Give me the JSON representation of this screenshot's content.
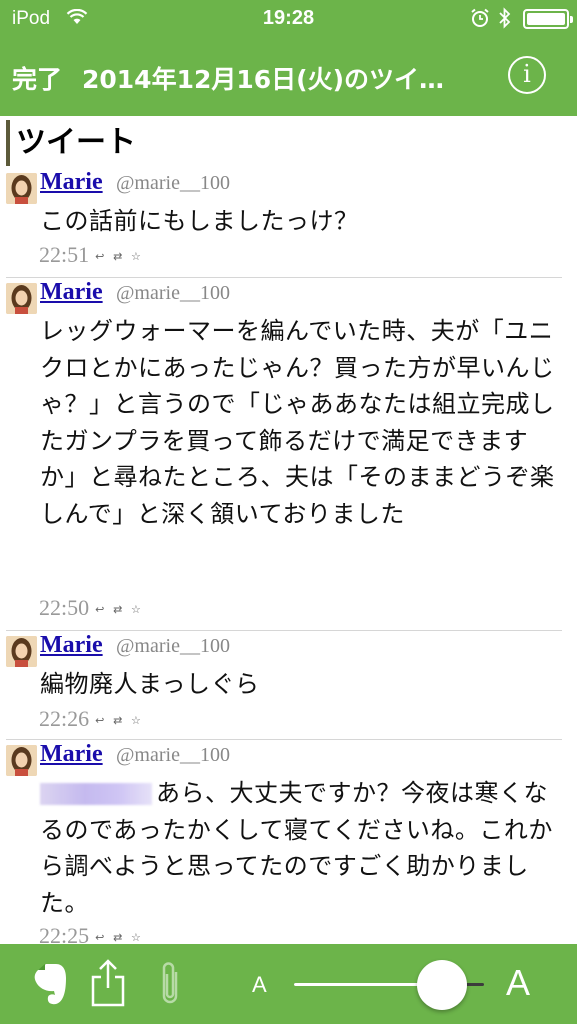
{
  "colors": {
    "accent": "#6cb44a",
    "link": "#1a0dab",
    "handle": "#888888"
  },
  "status_bar": {
    "carrier": "iPod",
    "time": "19:28"
  },
  "nav": {
    "done_label": "完了",
    "title": "2014年12月16日(火)のツイ…",
    "info_label": "i"
  },
  "section_heading": "ツイート",
  "tweets": [
    {
      "name": "Marie",
      "handle": "@marie__100",
      "text": "この話前にもしましたっけ？",
      "time": "22:51",
      "actions": "↩ ⇄ ☆"
    },
    {
      "name": "Marie",
      "handle": "@marie__100",
      "text": "レッグウォーマーを編んでいた時、夫が「ユニクロとかにあったじゃん？買った方が早いんじゃ？」と言うので「じゃああなたは組立完成したガンプラを買って飾るだけで満足できますか」と尋ねたところ、夫は「そのままどうぞ楽しんで」と深く頷いておりました",
      "time": "22:50",
      "actions": "↩ ⇄ ☆"
    },
    {
      "name": "Marie",
      "handle": "@marie__100",
      "text": "編物廃人まっしぐら",
      "time": "22:26",
      "actions": "↩ ⇄ ☆"
    },
    {
      "name": "Marie",
      "handle": "@marie__100",
      "text": "あら、大丈夫ですか？今夜は寒くなるのであったかくして寝てくださいね。これから調べようと思ってたのですごく助かりました。",
      "time": "22:25",
      "actions": "↩ ⇄ ☆"
    }
  ],
  "toolbar": {
    "icons": [
      "evernote-icon",
      "share-icon",
      "paperclip-icon"
    ],
    "font_small_label": "A",
    "font_large_label": "A",
    "font_size_level": 0.78
  }
}
